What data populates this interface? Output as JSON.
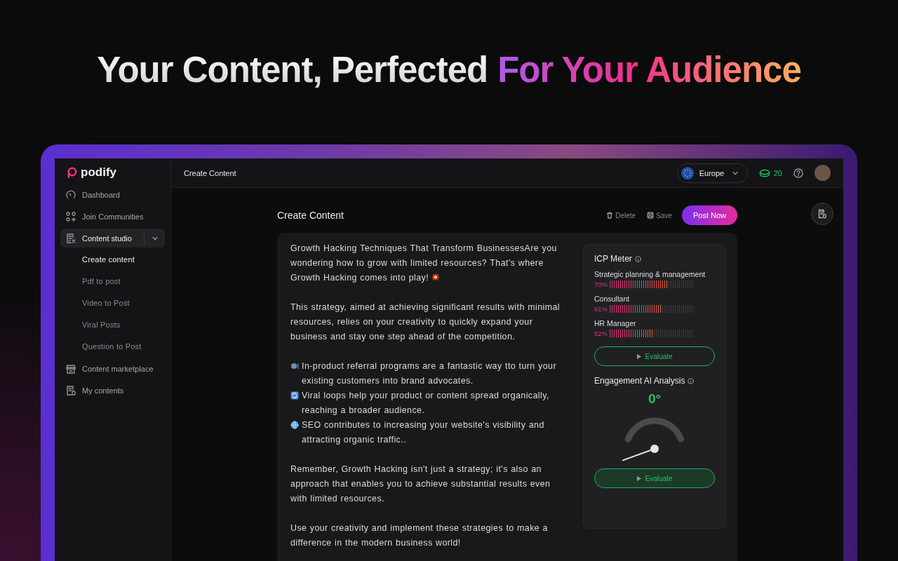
{
  "headline": {
    "lead": "Your Content, Perfected",
    "accent": "For Your Audience"
  },
  "app": {
    "brand": "podify",
    "sidebar": {
      "items": [
        {
          "label": "Dashboard",
          "kind": "link",
          "selected": false
        },
        {
          "label": "Join Communities",
          "kind": "link",
          "selected": false
        },
        {
          "label": "Content studio",
          "kind": "group",
          "selected": true,
          "expanded": true,
          "children": [
            {
              "label": "Create content",
              "selected": true
            },
            {
              "label": "Pdf to post",
              "selected": false
            },
            {
              "label": "Video to Post",
              "selected": false
            },
            {
              "label": "Viral Posts",
              "selected": false
            },
            {
              "label": "Question to Post",
              "selected": false
            }
          ]
        },
        {
          "label": "Content marketplace",
          "kind": "link",
          "selected": false
        },
        {
          "label": "My contents",
          "kind": "link",
          "selected": false
        }
      ]
    },
    "topbar": {
      "title": "Create Content",
      "region": "Europe",
      "credits": "20"
    },
    "editor": {
      "title": "Create Content",
      "actions": [
        {
          "label": "Delete",
          "kind": "delete"
        },
        {
          "label": "Save",
          "kind": "save"
        },
        {
          "label": "Post Now",
          "kind": "primary"
        }
      ],
      "post": [
        {
          "kind": "text",
          "text": "Growth Hacking Techniques That Transform BusinessesAre you wondering how to grow with limited resources? That's where Growth Hacking comes into play!",
          "burst_icon": true
        },
        {
          "kind": "text",
          "text": "This strategy, aimed at achieving significant results with minimal resources, relies on your creativity to quickly expand your business and stay one step ahead of the competition."
        },
        {
          "kind": "bullets",
          "items": [
            "In-product referral programs are a fantastic way tto turn your existing customers into brand advocates.",
            "Viral loops help your product or content spread organically, reaching a broader audience.",
            "SEO contributes to increasing your website's visibility and attracting organic traffic.."
          ]
        },
        {
          "kind": "text",
          "text": "Remember, Growth Hacking isn't just a strategy; it's also an approach that enables you to achieve substantial results even with limited resources."
        },
        {
          "kind": "text",
          "text": "Use your creativity and implement these strategies to make a difference in the modern business world!"
        }
      ]
    },
    "icp_meter": {
      "title": "ICP Meter",
      "rows": [
        {
          "name": "Strategic planning & management",
          "reading": "70%",
          "level": 0.7
        },
        {
          "name": "Consultant",
          "reading": "61%",
          "level": 0.61
        },
        {
          "name": "HR Manager",
          "reading": "52%",
          "level": 0.52
        }
      ],
      "button": {
        "label": "Evaluate",
        "kind": "outline"
      }
    },
    "engagement": {
      "title": "Engagement AI Analysis",
      "reading": "0°",
      "button": {
        "label": "Evaluate",
        "kind": "filled"
      }
    }
  }
}
